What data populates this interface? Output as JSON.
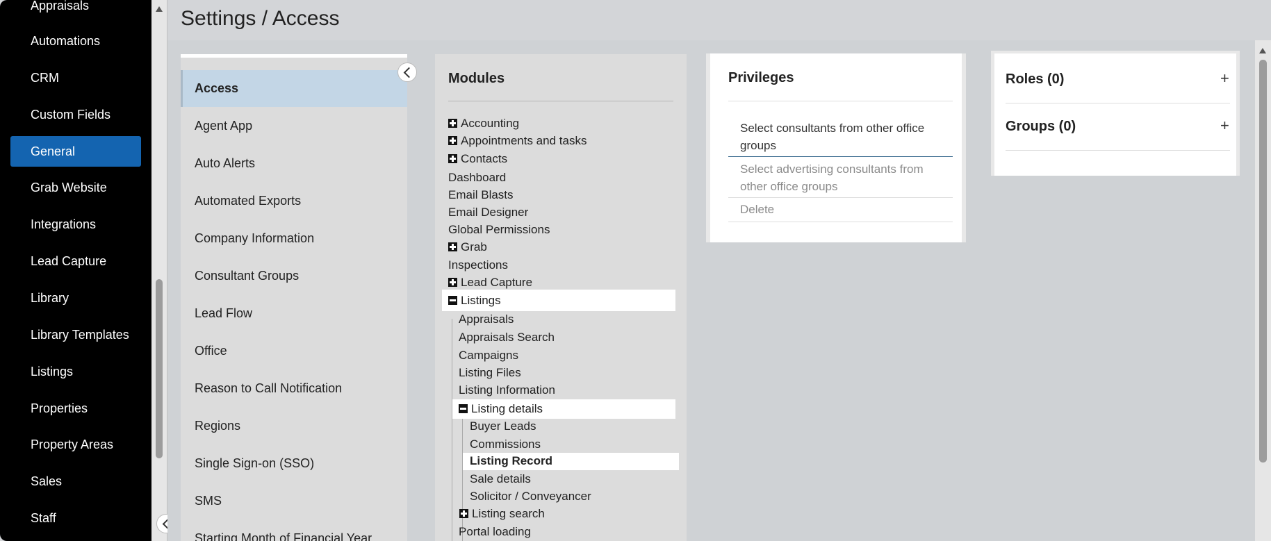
{
  "nav": {
    "items": [
      "Appraisals",
      "Automations",
      "CRM",
      "Custom Fields",
      "General",
      "Grab Website",
      "Integrations",
      "Lead Capture",
      "Library",
      "Library Templates",
      "Listings",
      "Properties",
      "Property Areas",
      "Sales",
      "Staff"
    ],
    "active": "General"
  },
  "header": {
    "title": "Settings / Access"
  },
  "submenu": {
    "items": [
      "Access",
      "Agent App",
      "Auto Alerts",
      "Automated Exports",
      "Company Information",
      "Consultant Groups",
      "Lead Flow",
      "Office",
      "Reason to Call Notification",
      "Regions",
      "Single Sign-on (SSO)",
      "SMS",
      "Starting Month of Financial Year"
    ],
    "active": "Access"
  },
  "modules": {
    "title": "Modules",
    "tree": [
      {
        "label": "Accounting",
        "icon": "plus"
      },
      {
        "label": "Appointments and tasks",
        "icon": "plus"
      },
      {
        "label": "Contacts",
        "icon": "plus"
      },
      {
        "label": "Dashboard"
      },
      {
        "label": "Email Blasts"
      },
      {
        "label": "Email Designer"
      },
      {
        "label": "Global Permissions"
      },
      {
        "label": "Grab",
        "icon": "plus"
      },
      {
        "label": "Inspections"
      },
      {
        "label": "Lead Capture",
        "icon": "plus"
      },
      {
        "label": "Listings",
        "icon": "minus",
        "highlight": true
      },
      {
        "label": "Appraisals"
      },
      {
        "label": "Appraisals Search"
      },
      {
        "label": "Campaigns"
      },
      {
        "label": "Listing Files"
      },
      {
        "label": "Listing Information"
      },
      {
        "label": "Listing details",
        "icon": "minus",
        "highlight": true
      },
      {
        "label": "Buyer Leads"
      },
      {
        "label": "Commissions"
      },
      {
        "label": "Listing Record",
        "highlight": true,
        "selected": true
      },
      {
        "label": "Sale details"
      },
      {
        "label": "Solicitor / Conveyancer"
      },
      {
        "label": "Listing search",
        "icon": "plus"
      },
      {
        "label": "Portal loading"
      }
    ]
  },
  "privileges": {
    "title": "Privileges",
    "items": [
      {
        "label": "Select consultants from other office groups",
        "state": "selected"
      },
      {
        "label": "Select advertising consultants from other office groups",
        "state": "dim"
      },
      {
        "label": "Delete",
        "state": "dim"
      }
    ]
  },
  "roles": {
    "label": "Roles (0)",
    "add": "+"
  },
  "groups": {
    "label": "Groups (0)",
    "add": "+"
  }
}
